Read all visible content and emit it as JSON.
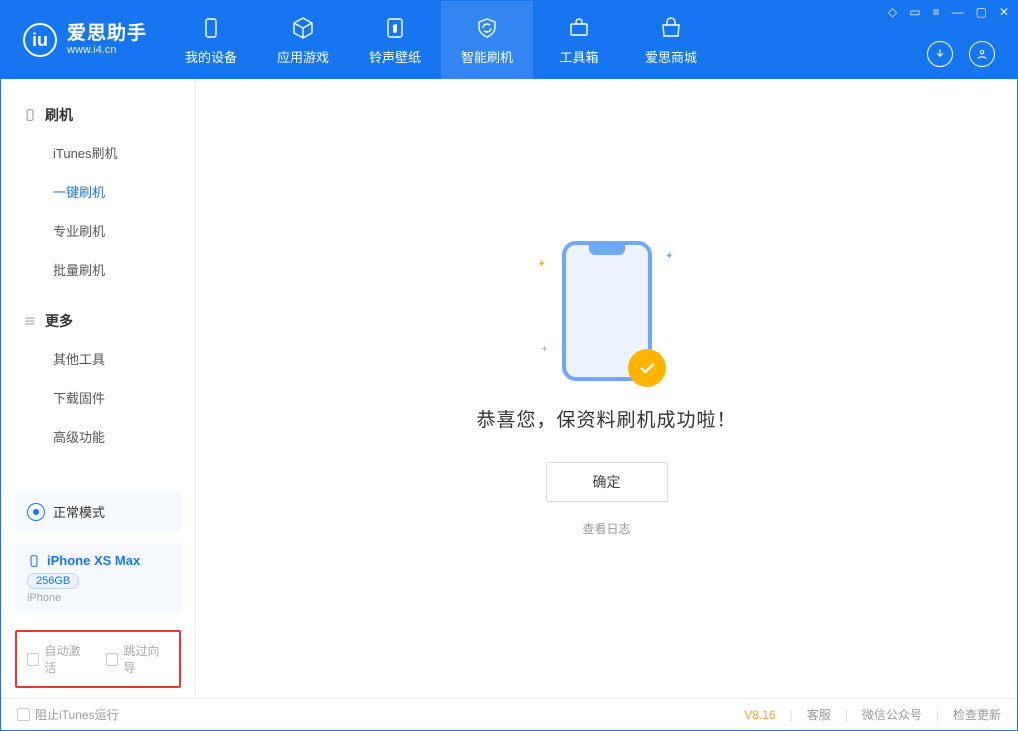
{
  "app": {
    "title": "爱思助手",
    "url": "www.i4.cn"
  },
  "nav": {
    "items": [
      {
        "label": "我的设备"
      },
      {
        "label": "应用游戏"
      },
      {
        "label": "铃声壁纸"
      },
      {
        "label": "智能刷机"
      },
      {
        "label": "工具箱"
      },
      {
        "label": "爱思商城"
      }
    ],
    "active_index": 3
  },
  "sidebar": {
    "group1": {
      "title": "刷机",
      "items": [
        "iTunes刷机",
        "一键刷机",
        "专业刷机",
        "批量刷机"
      ],
      "active_index": 1
    },
    "group2": {
      "title": "更多",
      "items": [
        "其他工具",
        "下载固件",
        "高级功能"
      ]
    },
    "mode_card": "正常模式",
    "device": {
      "name": "iPhone XS Max",
      "capacity": "256GB",
      "type": "iPhone"
    },
    "highlight_checks": [
      "自动激活",
      "跳过向导"
    ]
  },
  "main": {
    "success_message": "恭喜您，保资料刷机成功啦！",
    "ok_button": "确定",
    "view_log": "查看日志"
  },
  "footer": {
    "block_itunes": "阻止iTunes运行",
    "version": "V8.16",
    "links": [
      "客服",
      "微信公众号",
      "检查更新"
    ]
  }
}
